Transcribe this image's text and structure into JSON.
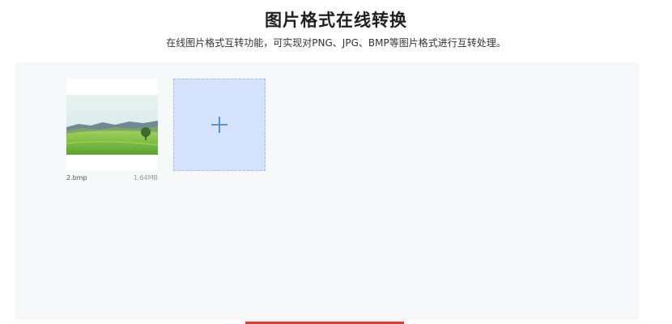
{
  "header": {
    "title": "图片格式在线转换",
    "subtitle": "在线图片格式互转功能，可实现对PNG、JPG、BMP等图片格式进行互转处理。"
  },
  "files": [
    {
      "name": "2.bmp",
      "size": "1.64MB",
      "thumbnail": "landscape-thumbnail"
    }
  ],
  "upload": {
    "icon": "plus-icon",
    "accent_color": "#4a86d6",
    "background_color": "#d4e3fb"
  },
  "action_button": {
    "color": "#e03a33"
  }
}
